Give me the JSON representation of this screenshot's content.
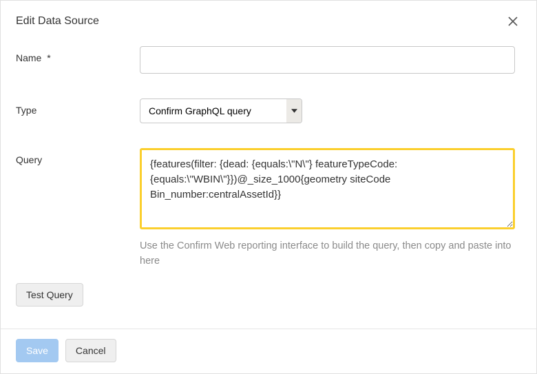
{
  "dialog": {
    "title": "Edit Data Source"
  },
  "form": {
    "name": {
      "label": "Name",
      "required_marker": "*",
      "value": ""
    },
    "type": {
      "label": "Type",
      "selected": "Confirm GraphQL query"
    },
    "query": {
      "label": "Query",
      "value": "{features(filter: {dead: {equals:\\\"N\\\"} featureTypeCode:{equals:\\\"WBIN\\\"}})@_size_1000{geometry siteCode Bin_number:centralAssetId}}",
      "helper": "Use the Confirm Web reporting interface to build the query, then copy and paste into here"
    }
  },
  "buttons": {
    "test_query": "Test Query",
    "save": "Save",
    "cancel": "Cancel"
  }
}
